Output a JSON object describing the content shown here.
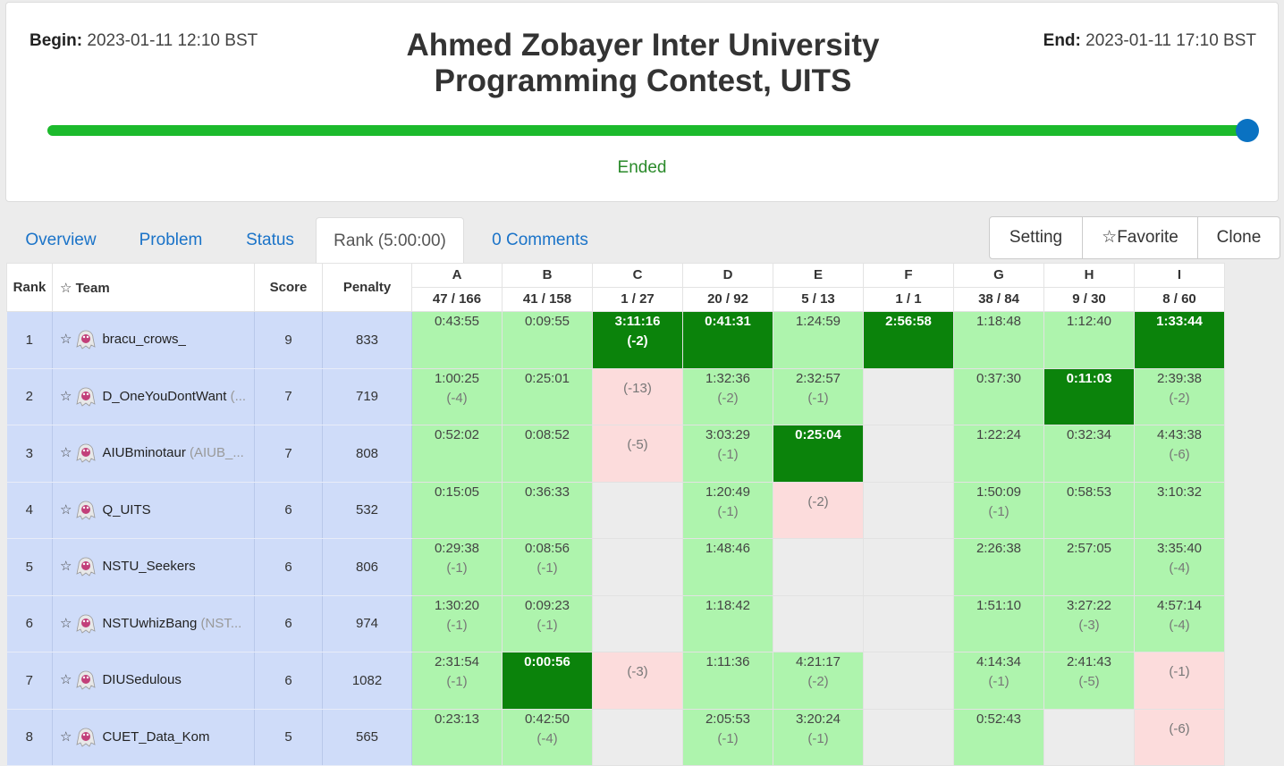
{
  "contest": {
    "begin_label": "Begin:",
    "begin_value": "2023-01-11 12:10 BST",
    "end_label": "End:",
    "end_value": "2023-01-11 17:10 BST",
    "title": "Ahmed Zobayer Inter University Programming Contest, UITS",
    "status": "Ended",
    "progress": 1.0
  },
  "tabs": [
    {
      "label": "Overview",
      "active": false
    },
    {
      "label": "Problem",
      "active": false
    },
    {
      "label": "Status",
      "active": false
    },
    {
      "label": "Rank (5:00:00)",
      "active": true
    },
    {
      "label": "0 Comments",
      "active": false
    }
  ],
  "actions": {
    "setting": "Setting",
    "favorite": "☆Favorite",
    "clone": "Clone"
  },
  "table": {
    "headers": {
      "rank": "Rank",
      "team": "☆ Team",
      "score": "Score",
      "penalty": "Penalty"
    },
    "problems": [
      {
        "letter": "A",
        "stat": "47 / 166"
      },
      {
        "letter": "B",
        "stat": "41 / 158"
      },
      {
        "letter": "C",
        "stat": "1 / 27"
      },
      {
        "letter": "D",
        "stat": "20 / 92"
      },
      {
        "letter": "E",
        "stat": "5 / 13"
      },
      {
        "letter": "F",
        "stat": "1 / 1"
      },
      {
        "letter": "G",
        "stat": "38 / 84"
      },
      {
        "letter": "H",
        "stat": "9 / 30"
      },
      {
        "letter": "I",
        "stat": "8 / 60"
      }
    ],
    "rows": [
      {
        "rank": "1",
        "team": "bracu_crows_",
        "extra": "",
        "score": "9",
        "penalty": "833",
        "cells": [
          {
            "s": "ac",
            "t": "0:43:55",
            "n": ""
          },
          {
            "s": "ac",
            "t": "0:09:55",
            "n": ""
          },
          {
            "s": "fb",
            "t": "3:11:16",
            "n": "(-2)"
          },
          {
            "s": "fb",
            "t": "0:41:31",
            "n": ""
          },
          {
            "s": "ac",
            "t": "1:24:59",
            "n": ""
          },
          {
            "s": "fb",
            "t": "2:56:58",
            "n": ""
          },
          {
            "s": "ac",
            "t": "1:18:48",
            "n": ""
          },
          {
            "s": "ac",
            "t": "1:12:40",
            "n": ""
          },
          {
            "s": "fb",
            "t": "1:33:44",
            "n": ""
          }
        ]
      },
      {
        "rank": "2",
        "team": "D_OneYouDontWant",
        "extra": " (...",
        "score": "7",
        "penalty": "719",
        "cells": [
          {
            "s": "ac",
            "t": "1:00:25",
            "n": "(-4)"
          },
          {
            "s": "ac",
            "t": "0:25:01",
            "n": ""
          },
          {
            "s": "wa",
            "t": "",
            "n": "(-13)"
          },
          {
            "s": "ac",
            "t": "1:32:36",
            "n": "(-2)"
          },
          {
            "s": "ac",
            "t": "2:32:57",
            "n": "(-1)"
          },
          {
            "s": "empty",
            "t": "",
            "n": ""
          },
          {
            "s": "ac",
            "t": "0:37:30",
            "n": ""
          },
          {
            "s": "fb",
            "t": "0:11:03",
            "n": ""
          },
          {
            "s": "ac",
            "t": "2:39:38",
            "n": "(-2)"
          }
        ]
      },
      {
        "rank": "3",
        "team": "AIUBminotaur",
        "extra": " (AIUB_...",
        "score": "7",
        "penalty": "808",
        "cells": [
          {
            "s": "ac",
            "t": "0:52:02",
            "n": ""
          },
          {
            "s": "ac",
            "t": "0:08:52",
            "n": ""
          },
          {
            "s": "wa",
            "t": "",
            "n": "(-5)"
          },
          {
            "s": "ac",
            "t": "3:03:29",
            "n": "(-1)"
          },
          {
            "s": "fb",
            "t": "0:25:04",
            "n": ""
          },
          {
            "s": "empty",
            "t": "",
            "n": ""
          },
          {
            "s": "ac",
            "t": "1:22:24",
            "n": ""
          },
          {
            "s": "ac",
            "t": "0:32:34",
            "n": ""
          },
          {
            "s": "ac",
            "t": "4:43:38",
            "n": "(-6)"
          }
        ]
      },
      {
        "rank": "4",
        "team": "Q_UITS",
        "extra": "",
        "score": "6",
        "penalty": "532",
        "cells": [
          {
            "s": "ac",
            "t": "0:15:05",
            "n": ""
          },
          {
            "s": "ac",
            "t": "0:36:33",
            "n": ""
          },
          {
            "s": "empty",
            "t": "",
            "n": ""
          },
          {
            "s": "ac",
            "t": "1:20:49",
            "n": "(-1)"
          },
          {
            "s": "wa",
            "t": "",
            "n": "(-2)"
          },
          {
            "s": "empty",
            "t": "",
            "n": ""
          },
          {
            "s": "ac",
            "t": "1:50:09",
            "n": "(-1)"
          },
          {
            "s": "ac",
            "t": "0:58:53",
            "n": ""
          },
          {
            "s": "ac",
            "t": "3:10:32",
            "n": ""
          }
        ]
      },
      {
        "rank": "5",
        "team": "NSTU_Seekers",
        "extra": "",
        "score": "6",
        "penalty": "806",
        "cells": [
          {
            "s": "ac",
            "t": "0:29:38",
            "n": "(-1)"
          },
          {
            "s": "ac",
            "t": "0:08:56",
            "n": "(-1)"
          },
          {
            "s": "empty",
            "t": "",
            "n": ""
          },
          {
            "s": "ac",
            "t": "1:48:46",
            "n": ""
          },
          {
            "s": "empty",
            "t": "",
            "n": ""
          },
          {
            "s": "empty",
            "t": "",
            "n": ""
          },
          {
            "s": "ac",
            "t": "2:26:38",
            "n": ""
          },
          {
            "s": "ac",
            "t": "2:57:05",
            "n": ""
          },
          {
            "s": "ac",
            "t": "3:35:40",
            "n": "(-4)"
          }
        ]
      },
      {
        "rank": "6",
        "team": "NSTUwhizBang",
        "extra": " (NST...",
        "score": "6",
        "penalty": "974",
        "cells": [
          {
            "s": "ac",
            "t": "1:30:20",
            "n": "(-1)"
          },
          {
            "s": "ac",
            "t": "0:09:23",
            "n": "(-1)"
          },
          {
            "s": "empty",
            "t": "",
            "n": ""
          },
          {
            "s": "ac",
            "t": "1:18:42",
            "n": ""
          },
          {
            "s": "empty",
            "t": "",
            "n": ""
          },
          {
            "s": "empty",
            "t": "",
            "n": ""
          },
          {
            "s": "ac",
            "t": "1:51:10",
            "n": ""
          },
          {
            "s": "ac",
            "t": "3:27:22",
            "n": "(-3)"
          },
          {
            "s": "ac",
            "t": "4:57:14",
            "n": "(-4)"
          }
        ]
      },
      {
        "rank": "7",
        "team": "DIUSedulous",
        "extra": "",
        "score": "6",
        "penalty": "1082",
        "cells": [
          {
            "s": "ac",
            "t": "2:31:54",
            "n": "(-1)"
          },
          {
            "s": "fb",
            "t": "0:00:56",
            "n": ""
          },
          {
            "s": "wa",
            "t": "",
            "n": "(-3)"
          },
          {
            "s": "ac",
            "t": "1:11:36",
            "n": ""
          },
          {
            "s": "ac",
            "t": "4:21:17",
            "n": "(-2)"
          },
          {
            "s": "empty",
            "t": "",
            "n": ""
          },
          {
            "s": "ac",
            "t": "4:14:34",
            "n": "(-1)"
          },
          {
            "s": "ac",
            "t": "2:41:43",
            "n": "(-5)"
          },
          {
            "s": "wa",
            "t": "",
            "n": "(-1)"
          }
        ]
      },
      {
        "rank": "8",
        "team": "CUET_Data_Kom",
        "extra": "",
        "score": "5",
        "penalty": "565",
        "cells": [
          {
            "s": "ac",
            "t": "0:23:13",
            "n": ""
          },
          {
            "s": "ac",
            "t": "0:42:50",
            "n": "(-4)"
          },
          {
            "s": "empty",
            "t": "",
            "n": ""
          },
          {
            "s": "ac",
            "t": "2:05:53",
            "n": "(-1)"
          },
          {
            "s": "ac",
            "t": "3:20:24",
            "n": "(-1)"
          },
          {
            "s": "empty",
            "t": "",
            "n": ""
          },
          {
            "s": "ac",
            "t": "0:52:43",
            "n": ""
          },
          {
            "s": "empty",
            "t": "",
            "n": ""
          },
          {
            "s": "wa",
            "t": "",
            "n": "(-6)"
          }
        ]
      }
    ]
  },
  "colors": {
    "accepted": "#aef4ad",
    "first_blood": "#0b830b",
    "wrong": "#fcdcdc",
    "team_info_bg": "#cfdcf9",
    "progress_fill": "#1cba2c",
    "link": "#1a73c8"
  }
}
